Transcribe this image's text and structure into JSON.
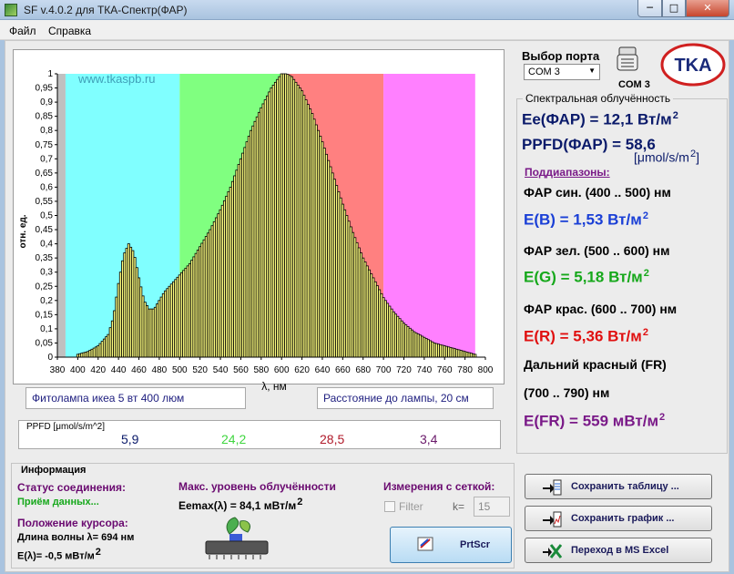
{
  "window": {
    "title": "SF v.4.0.2 для ТКА-Спектр(ФАР)",
    "min_glyph": "─",
    "max_glyph": "□",
    "close_glyph": "✕"
  },
  "menu": [
    "Файл",
    "Справка"
  ],
  "colors": {
    "blue_band": "#80ffff",
    "green_band": "#80ff80",
    "red_band": "#ff8080",
    "far_red_band": "#ff80ff",
    "gray_band": "#c0c0c0",
    "bar_fill": "#ffff80"
  },
  "chart_data": {
    "type": "bar",
    "ylabel": "отн. ед.",
    "xlabel": "λ, нм",
    "watermark": "www.tkaspb.ru",
    "xlim": [
      380,
      800
    ],
    "ylim": [
      0,
      1
    ],
    "xticks": [
      380,
      400,
      420,
      440,
      460,
      480,
      500,
      520,
      540,
      560,
      580,
      600,
      620,
      640,
      660,
      680,
      700,
      720,
      740,
      760,
      780,
      800
    ],
    "yticks": [
      "0",
      "0,05",
      "0,1",
      "0,15",
      "0,2",
      "0,25",
      "0,3",
      "0,35",
      "0,4",
      "0,45",
      "0,5",
      "0,55",
      "0,6",
      "0,65",
      "0,7",
      "0,75",
      "0,8",
      "0,85",
      "0,9",
      "0,95",
      "1"
    ],
    "bands": [
      {
        "name": "gray",
        "from": 380,
        "to": 388
      },
      {
        "name": "blue",
        "from": 388,
        "to": 500
      },
      {
        "name": "green",
        "from": 500,
        "to": 600
      },
      {
        "name": "red",
        "from": 600,
        "to": 700
      },
      {
        "name": "far-red",
        "from": 700,
        "to": 790
      }
    ],
    "spectrum": [
      [
        400,
        0.01
      ],
      [
        410,
        0.02
      ],
      [
        420,
        0.04
      ],
      [
        430,
        0.08
      ],
      [
        435,
        0.14
      ],
      [
        440,
        0.26
      ],
      [
        445,
        0.36
      ],
      [
        450,
        0.4
      ],
      [
        455,
        0.37
      ],
      [
        460,
        0.28
      ],
      [
        465,
        0.2
      ],
      [
        470,
        0.17
      ],
      [
        475,
        0.17
      ],
      [
        480,
        0.2
      ],
      [
        485,
        0.23
      ],
      [
        490,
        0.25
      ],
      [
        500,
        0.29
      ],
      [
        510,
        0.33
      ],
      [
        520,
        0.39
      ],
      [
        530,
        0.45
      ],
      [
        540,
        0.52
      ],
      [
        550,
        0.6
      ],
      [
        560,
        0.7
      ],
      [
        570,
        0.8
      ],
      [
        580,
        0.88
      ],
      [
        590,
        0.95
      ],
      [
        600,
        1.0
      ],
      [
        605,
        1.0
      ],
      [
        610,
        0.99
      ],
      [
        620,
        0.94
      ],
      [
        630,
        0.86
      ],
      [
        640,
        0.76
      ],
      [
        650,
        0.65
      ],
      [
        660,
        0.54
      ],
      [
        670,
        0.44
      ],
      [
        680,
        0.35
      ],
      [
        690,
        0.28
      ],
      [
        700,
        0.21
      ],
      [
        710,
        0.16
      ],
      [
        720,
        0.12
      ],
      [
        730,
        0.09
      ],
      [
        740,
        0.07
      ],
      [
        750,
        0.05
      ],
      [
        760,
        0.04
      ],
      [
        770,
        0.03
      ],
      [
        780,
        0.02
      ],
      [
        790,
        0.01
      ]
    ]
  },
  "chart_boxes": {
    "lamp": "Фитолампа икеа 5 вт 400 люм",
    "distance": "Расстояние до лампы, 20 см"
  },
  "ppfd": {
    "title": "PPFD [μmol/s/m^2]",
    "blue": "5,9",
    "green": "24,2",
    "red": "28,5",
    "far_red": "3,4"
  },
  "port": {
    "label": "Выбор порта",
    "selected": "COM 3",
    "name": "COM 3"
  },
  "logo_text": "TKA",
  "spectral": {
    "title": "Спектральная облучённость",
    "ee": "Ee(ФАР) = 12,1 Вт/м",
    "ppfd": "PPFD(ФАР) = 58,6",
    "ppfd_unit": "[μmol/s/m",
    "ppfd_unit_end": "]",
    "sub": "Поддиапазоны:",
    "blue_range": "ФАР син. (400 .. 500) нм",
    "eb": "E(B) = 1,53 Вт/м",
    "green_range": "ФАР зел. (500 .. 600) нм",
    "eg": "E(G) = 5,18 Вт/м",
    "red_range": "ФАР крас. (600 .. 700) нм",
    "er": "E(R) = 5,36 Вт/м",
    "fr_title": "Дальний красный (FR)",
    "fr_range": "(700 .. 790) нм",
    "efr": "E(FR) = 559 мВт/м",
    "sq": "2"
  },
  "info": {
    "title": "Информация",
    "status_label": "Статус соединения:",
    "status": "Приём данных...",
    "cursor_label": "Положение курсора:",
    "wavelength": "Длина волны λ= 694 нм",
    "e_lambda": "E(λ)= -0,5 мВт/м",
    "max_label": "Макс. уровень облучённости",
    "emax": "Eemax(λ) = 84,1 мВт/м",
    "grid_label": "Измерения с сеткой:",
    "filter": "Filter",
    "k_label": "k=",
    "k_value": "15",
    "prtscr": "PrtScr"
  },
  "actions": {
    "save_table": "Сохранить таблицу ...",
    "save_graph": "Сохранить график ...",
    "excel": "Переход в MS Excel"
  }
}
